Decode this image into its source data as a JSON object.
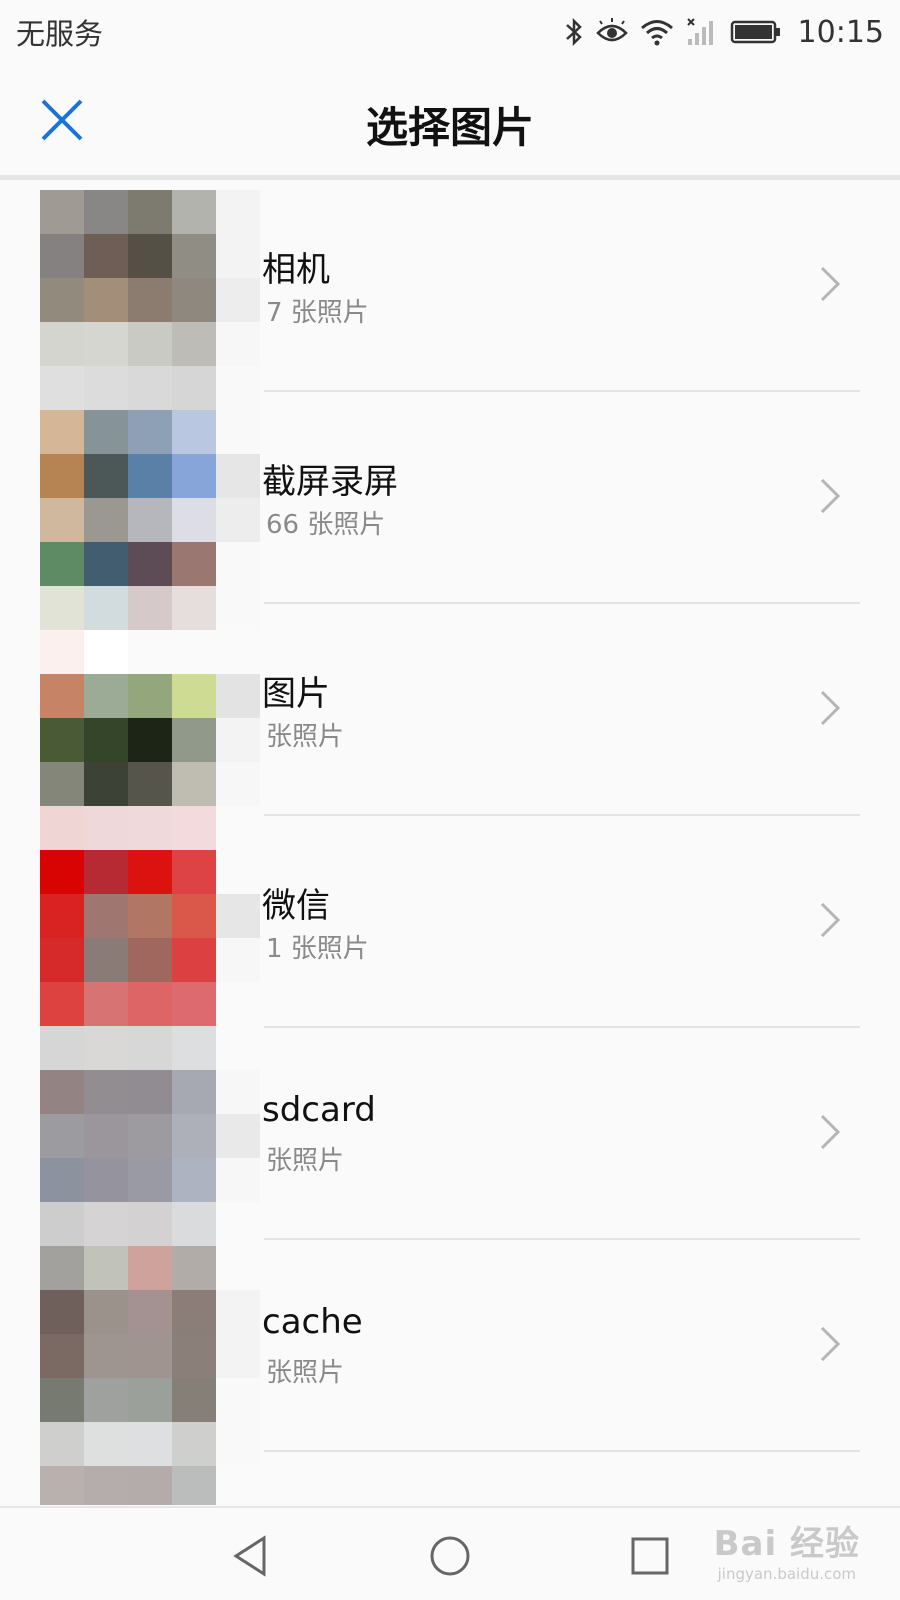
{
  "status_bar": {
    "carrier": "无服务",
    "time": "10:15",
    "icons": [
      "bluetooth-icon",
      "eye-comfort-icon",
      "wifi-icon",
      "signal-icon",
      "battery-icon"
    ]
  },
  "header": {
    "title": "选择图片",
    "close_icon": "close-icon",
    "accent_color": "#1a73d9"
  },
  "albums": [
    {
      "name": "相机",
      "count": "7 张照片"
    },
    {
      "name": "截屏录屏",
      "count": "66 张照片"
    },
    {
      "name": "图片",
      "count": "张照片"
    },
    {
      "name": "微信",
      "count": "1 张照片"
    },
    {
      "name": "sdcard",
      "count": "张照片"
    },
    {
      "name": "cache",
      "count": "张照片"
    }
  ],
  "nav_bar": {
    "back_icon": "back-triangle-icon",
    "home_icon": "home-circle-icon",
    "recents_icon": "recents-square-icon"
  },
  "watermark": {
    "main": "Bai 经验",
    "sub": "jingyan.baidu.com"
  }
}
